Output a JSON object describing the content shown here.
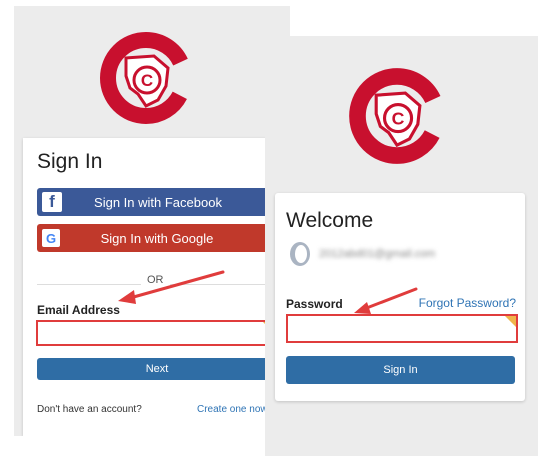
{
  "colors": {
    "brand_red": "#c8102e",
    "facebook_blue": "#3b5998",
    "google_red": "#c0392b",
    "primary_blue": "#2f6da5",
    "link_blue": "#2f74b5",
    "highlight_red": "#e03c3c",
    "autofill_orange": "#f0b44a"
  },
  "sign_in_screen": {
    "logo_icon": "logo-c-emblem-icon",
    "title": "Sign In",
    "facebook_icon": "f",
    "facebook_label": "Sign In with Facebook",
    "google_icon": "G",
    "google_label": "Sign In with Google",
    "divider_text": "OR",
    "email_label": "Email Address",
    "email_value": "",
    "next_label": "Next",
    "no_account_text": "Don't have an account?",
    "create_link": "Create one now"
  },
  "welcome_screen": {
    "logo_icon": "logo-c-emblem-icon",
    "title": "Welcome",
    "avatar_icon": "user-avatar-icon",
    "account_email": "2012abd01@gmail.com",
    "password_label": "Password",
    "forgot_link": "Forgot Password?",
    "password_value": "",
    "sign_in_label": "Sign In"
  }
}
